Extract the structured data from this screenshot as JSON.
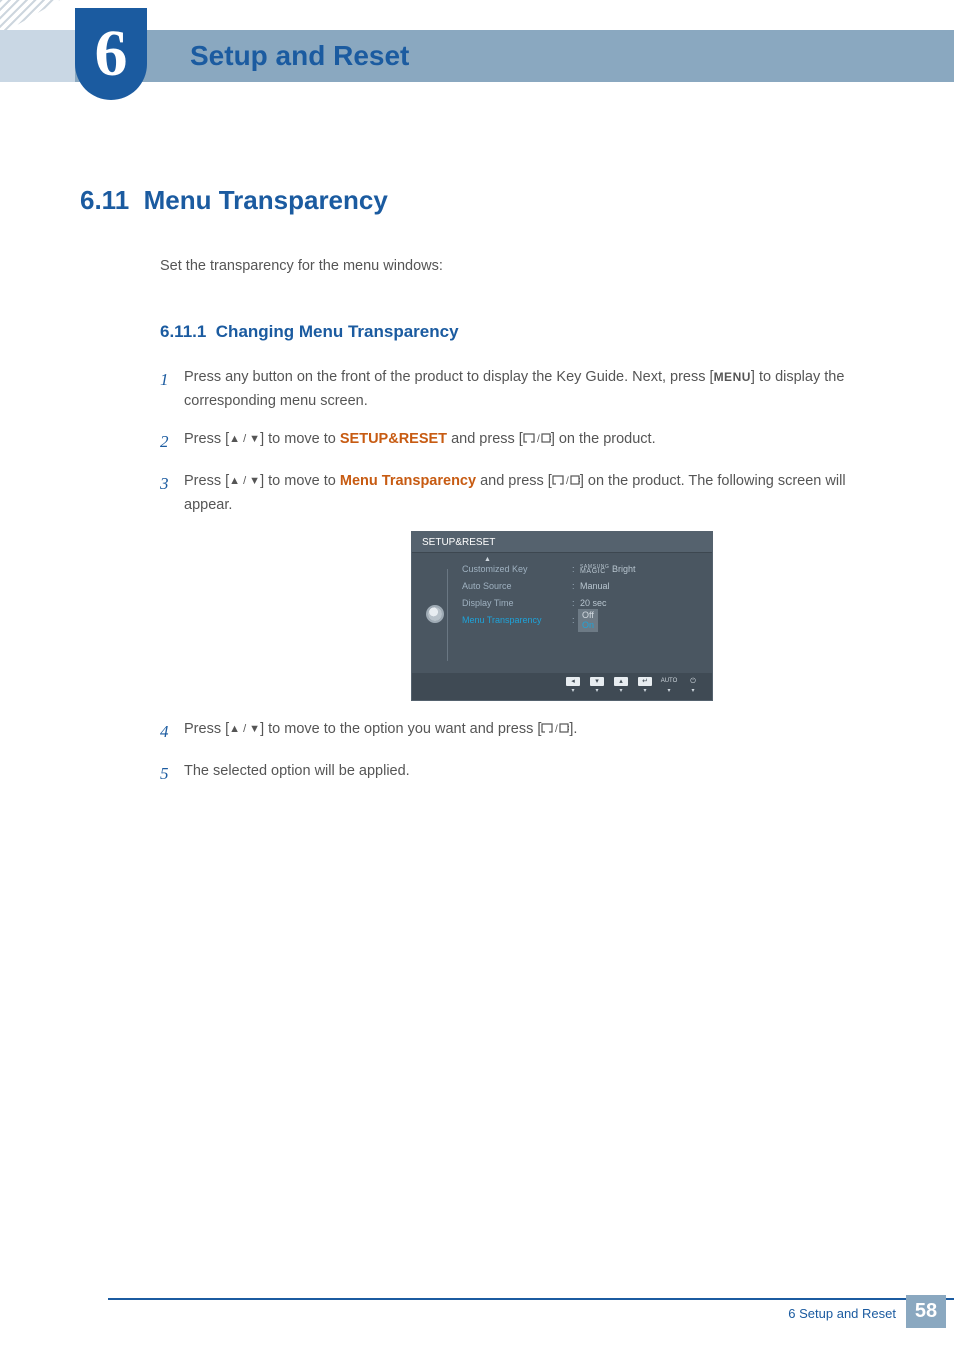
{
  "chapter": {
    "number": "6",
    "title": "Setup and Reset"
  },
  "section": {
    "number": "6.11",
    "title": "Menu Transparency"
  },
  "intro": "Set the transparency for the menu windows:",
  "subsection": {
    "number": "6.11.1",
    "title": "Changing Menu Transparency"
  },
  "steps": {
    "s1_a": "Press any button on the front of the product to display the Key Guide. Next, press [",
    "s1_menu": "MENU",
    "s1_b": "] to display the corresponding menu screen.",
    "s2_a": "Press [",
    "s2_b": "] to move to ",
    "s2_hl": "SETUP&RESET",
    "s2_c": " and press [",
    "s2_d": "] on the product.",
    "s3_a": "Press [",
    "s3_b": "] to move to ",
    "s3_hl": "Menu Transparency",
    "s3_c": " and press [",
    "s3_d": "] on the product. The following screen will appear.",
    "s4_a": "Press [",
    "s4_b": "] to move to the option you want and press [",
    "s4_c": "].",
    "s5": "The selected option will be applied."
  },
  "osd": {
    "title": "SETUP&RESET",
    "rows": [
      {
        "label": "Customized Key",
        "value_prefix": "SAMSUNG",
        "value_suffix": "Bright",
        "magic": "MAGIC"
      },
      {
        "label": "Auto Source",
        "value": "Manual"
      },
      {
        "label": "Display Time",
        "value": "20 sec"
      },
      {
        "label": "Menu Transparency",
        "opt_off": "Off",
        "opt_on": "On"
      }
    ],
    "guide": {
      "auto": "AUTO"
    }
  },
  "footer": {
    "label": "6 Setup and Reset",
    "page": "58"
  }
}
